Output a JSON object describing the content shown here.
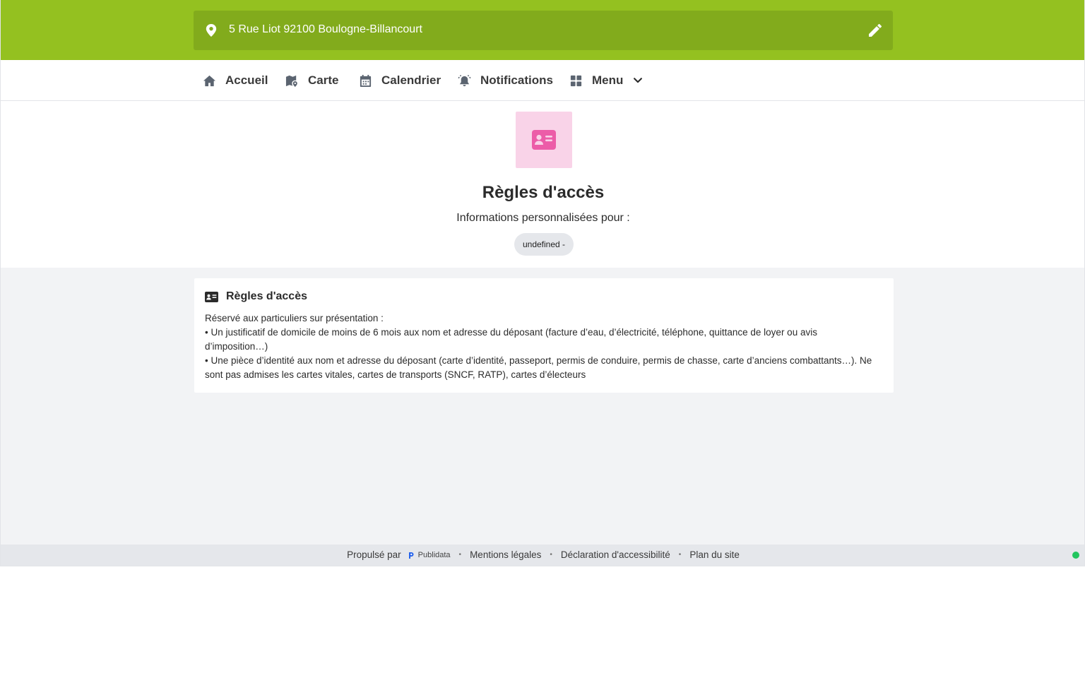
{
  "header": {
    "address": "5 Rue Liot 92100 Boulogne-Billancourt",
    "icons": {
      "location": "map-pin-icon",
      "edit": "pencil-icon"
    },
    "colors": {
      "bar": "#94c120",
      "address_box": "#82ab1c"
    }
  },
  "nav": {
    "items": [
      {
        "label": "Accueil",
        "icon": "home-icon"
      },
      {
        "label": "Carte",
        "icon": "map-icon"
      },
      {
        "label": "Calendrier",
        "icon": "calendar-icon"
      },
      {
        "label": "Notifications",
        "icon": "bell-icon"
      },
      {
        "label": "Menu",
        "icon": "grid-icon"
      }
    ]
  },
  "hero": {
    "icon": "id-card-icon",
    "icon_bg": "#f9d3e8",
    "icon_color": "#ec5ca8",
    "title": "Règles d'accès",
    "subtitle": "Informations personnalisées pour :",
    "chip": "undefined -"
  },
  "card": {
    "icon": "id-card-icon",
    "title": "Règles d'accès",
    "lines": [
      "Réservé aux particuliers sur présentation :",
      "• Un justificatif de domicile de moins de 6 mois aux nom et adresse du déposant (facture d’eau, d’électricité, téléphone, quittance de loyer ou avis d’imposition…)",
      "• Une pièce d’identité aux nom et adresse du déposant (carte d’identité, passeport, permis de conduire, permis de chasse, carte d’anciens combattants…). Ne sont pas admises les cartes vitales, cartes de transports (SNCF, RATP), cartes d’électeurs"
    ]
  },
  "footer": {
    "powered_by": "Propulsé par",
    "brand": "Publidata",
    "links": [
      "Mentions légales",
      "Déclaration d'accessibilité",
      "Plan du site"
    ],
    "status_color": "#22c55e"
  }
}
